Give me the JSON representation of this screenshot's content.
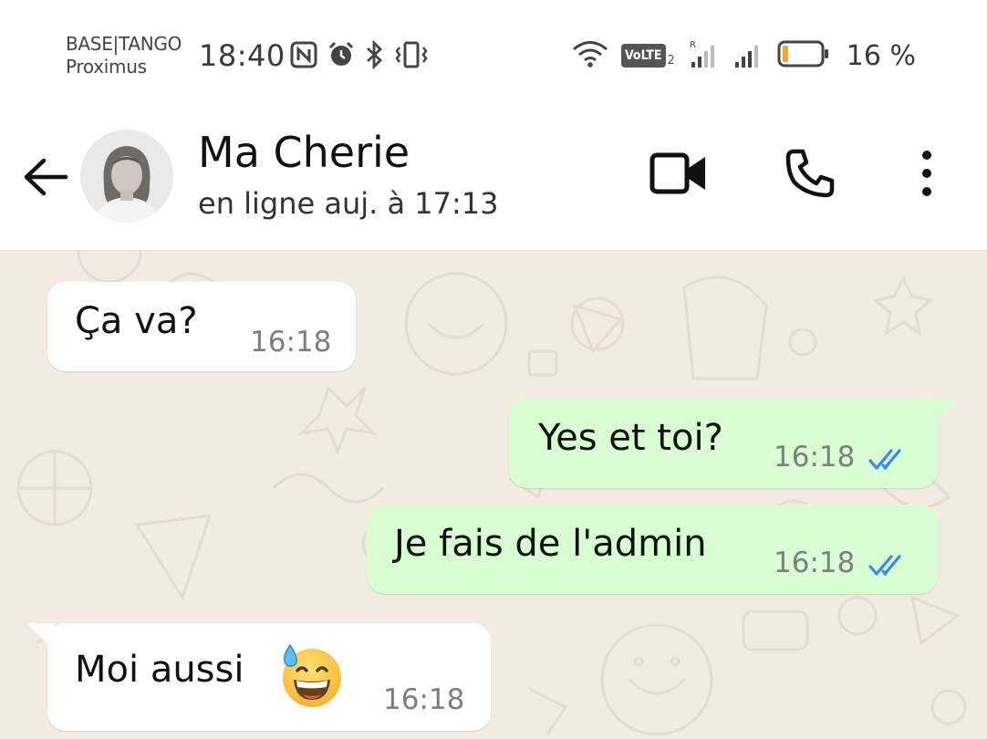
{
  "status_bar": {
    "carrier_line1": "BASE|TANGO",
    "carrier_line2": "Proximus",
    "time": "18:40",
    "volte_label": "VoLTE",
    "volte_sim": "2",
    "battery_percent": "16 %",
    "battery_level": 0.16,
    "icons_left": [
      "nfc-icon",
      "alarm-icon",
      "bluetooth-icon",
      "vibrate-icon"
    ],
    "icons_right": [
      "wifi-icon",
      "volte-icon",
      "signal-roaming-icon",
      "signal-icon",
      "battery-icon"
    ]
  },
  "header": {
    "contact_name": "Ma Cherie",
    "contact_status": "en ligne auj. à 17:13",
    "icons": [
      "back-arrow-icon",
      "video-call-icon",
      "phone-icon",
      "more-vert-icon"
    ]
  },
  "messages": [
    {
      "direction": "in",
      "text": "Ça va?",
      "time": "16:18"
    },
    {
      "direction": "out",
      "text": "Yes et toi?",
      "time": "16:18",
      "status": "read"
    },
    {
      "direction": "out",
      "text": "Je fais de l'admin",
      "time": "16:18",
      "status": "read"
    },
    {
      "direction": "in",
      "text": "Moi aussi",
      "emoji": "grinning-face-with-sweat",
      "time": "16:18"
    }
  ],
  "colors": {
    "chat_background": "#f2ebe2",
    "outgoing_bubble": "#d9fdd3",
    "incoming_bubble": "#ffffff",
    "read_ticks": "#3a8be6",
    "battery_low": "#f5a623"
  }
}
